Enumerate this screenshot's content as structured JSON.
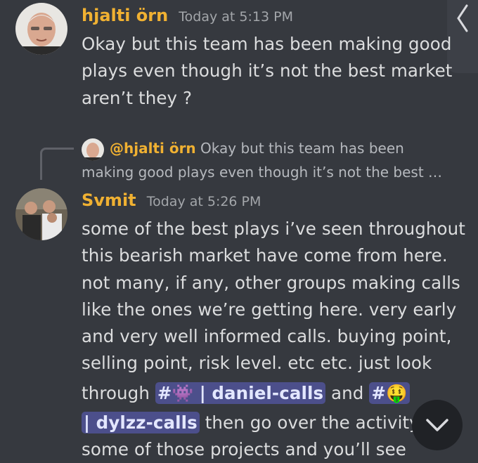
{
  "messages": [
    {
      "author": "hjalti örn",
      "time": "Today at 5:13 PM",
      "lines": [
        "Okay but this team has been making good",
        "plays even though it’s not the best market",
        "aren’t they ?"
      ]
    },
    {
      "author": "Svmit",
      "time": "Today at 5:26 PM",
      "reply": {
        "author": "@hjalti örn",
        "line1": "Okay but this team has been",
        "line2": "making good plays even though it’s not the best …"
      },
      "lines": [
        "some of the best plays i’ve seen throughout",
        "this bearish market have come from here.",
        "not many, if any, other groups making calls",
        "like the ones we’re getting here.  very early",
        "and very well informed calls.  buying point,",
        "selling point, risk level.  etc etc.  just look"
      ],
      "line7_before": "through ",
      "mention1": "#👾 | daniel-calls",
      "line7_mid": " and ",
      "mention2_a": "#🤑",
      "mention2_b": " | dylzz-calls",
      "line8_after": " then go over the activity o",
      "line9": "some of those projects and you’ll see"
    }
  ],
  "colors": {
    "background": "#36393f",
    "author": "#f0b132",
    "mention_bg": "#4c4f8b"
  },
  "icons": {
    "back": "chevron-left-icon",
    "jump": "chevron-down-icon"
  },
  "ui": {
    "back_glyph": "❬"
  }
}
